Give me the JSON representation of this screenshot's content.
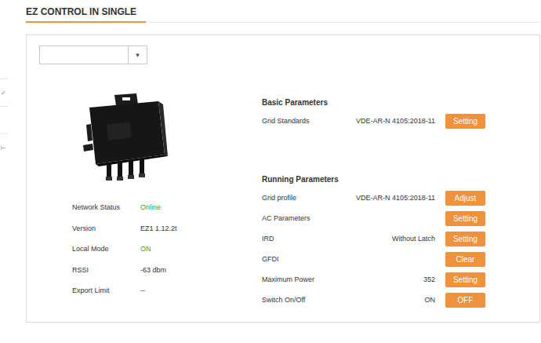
{
  "page": {
    "title": "EZ CONTROL IN SINGLE"
  },
  "sidebar": {
    "items": [
      {
        "mark": "✓"
      },
      {
        "mark": ""
      },
      {
        "mark": "⊢"
      }
    ]
  },
  "device_select": {
    "value": "",
    "arrow": "▼"
  },
  "status": [
    {
      "label": "Network Status",
      "value": "Online",
      "color": "#2ea52e"
    },
    {
      "label": "Version",
      "value": "EZ1 1.12.2t",
      "color": "#333333"
    },
    {
      "label": "Local Mode",
      "value": "ON",
      "color": "#2ea52e"
    },
    {
      "label": "RSSI",
      "value": "-63 dbm",
      "color": "#333333"
    },
    {
      "label": "Export Limit",
      "value": "--",
      "color": "#333333"
    }
  ],
  "basic_parameters": {
    "title": "Basic Parameters",
    "rows": [
      {
        "label": "Grid Standards",
        "value": "VDE-AR-N 4105:2018-11",
        "button": "Setting"
      }
    ]
  },
  "running_parameters": {
    "title": "Running Parameters",
    "rows": [
      {
        "label": "Grid profile",
        "value": "VDE-AR-N 4105:2018-11",
        "button": "Adjust"
      },
      {
        "label": "AC Parameters",
        "value": "",
        "button": "Setting"
      },
      {
        "label": "IRD",
        "value": "Without Latch",
        "button": "Setting"
      },
      {
        "label": "GFDI",
        "value": "",
        "button": "Clear"
      },
      {
        "label": "Maximum Power",
        "value": "352",
        "button": "Setting"
      },
      {
        "label": "Switch On/Off",
        "value": "ON",
        "button": "OFF"
      }
    ]
  }
}
